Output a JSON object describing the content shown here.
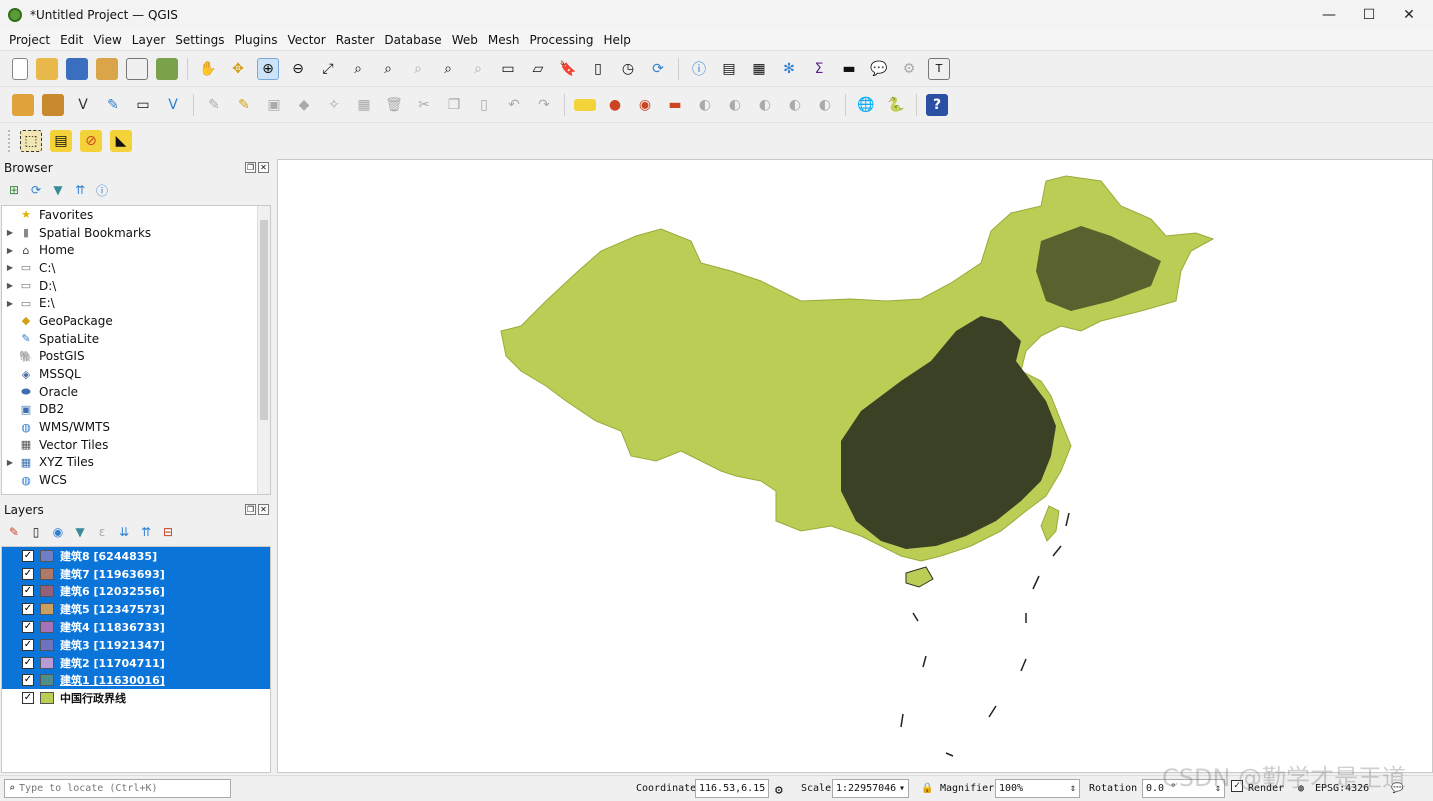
{
  "window": {
    "title": "*Untitled Project — QGIS",
    "minimize": "—",
    "maximize": "☐",
    "close": "✕"
  },
  "menu": [
    "Project",
    "Edit",
    "View",
    "Layer",
    "Settings",
    "Plugins",
    "Vector",
    "Raster",
    "Database",
    "Web",
    "Mesh",
    "Processing",
    "Help"
  ],
  "browser": {
    "title": "Browser",
    "items": [
      {
        "label": "Favorites",
        "icon": "star-icon",
        "expandable": false
      },
      {
        "label": "Spatial Bookmarks",
        "icon": "bookmark-icon",
        "expandable": true
      },
      {
        "label": "Home",
        "icon": "home-icon",
        "expandable": true
      },
      {
        "label": "C:\\",
        "icon": "folder-icon",
        "expandable": true
      },
      {
        "label": "D:\\",
        "icon": "folder-icon",
        "expandable": true
      },
      {
        "label": "E:\\",
        "icon": "folder-icon",
        "expandable": true
      },
      {
        "label": "GeoPackage",
        "icon": "geopackage-icon",
        "expandable": false
      },
      {
        "label": "SpatiaLite",
        "icon": "spatialite-icon",
        "expandable": false
      },
      {
        "label": "PostGIS",
        "icon": "postgis-icon",
        "expandable": false
      },
      {
        "label": "MSSQL",
        "icon": "mssql-icon",
        "expandable": false
      },
      {
        "label": "Oracle",
        "icon": "oracle-icon",
        "expandable": false
      },
      {
        "label": "DB2",
        "icon": "db2-icon",
        "expandable": false
      },
      {
        "label": "WMS/WMTS",
        "icon": "globe-icon",
        "expandable": false
      },
      {
        "label": "Vector Tiles",
        "icon": "grid-icon",
        "expandable": false
      },
      {
        "label": "XYZ Tiles",
        "icon": "tiles-icon",
        "expandable": true
      },
      {
        "label": "WCS",
        "icon": "globe-icon",
        "expandable": false
      }
    ]
  },
  "layers": {
    "title": "Layers",
    "items": [
      {
        "label": "建筑8 [6244835]",
        "color": "#6f7fc6",
        "selected": true
      },
      {
        "label": "建筑7 [11963693]",
        "color": "#b07868",
        "selected": true
      },
      {
        "label": "建筑6 [12032556]",
        "color": "#94607a",
        "selected": true
      },
      {
        "label": "建筑5 [12347573]",
        "color": "#c9a062",
        "selected": true
      },
      {
        "label": "建筑4 [11836733]",
        "color": "#a473b8",
        "selected": true
      },
      {
        "label": "建筑3 [11921347]",
        "color": "#6e72c0",
        "selected": true
      },
      {
        "label": "建筑2 [11704711]",
        "color": "#b79ad6",
        "selected": true
      },
      {
        "label": "建筑1 [11630016]",
        "color": "#4f8f8a",
        "selected": true
      },
      {
        "label": "中国行政界线",
        "color": "#bccd56",
        "selected": false
      }
    ]
  },
  "status": {
    "locate_placeholder": "Type to locate (Ctrl+K)",
    "coordinate_label": "Coordinate",
    "coordinate_value": "116.53,6.15",
    "scale_label": "Scale",
    "scale_value": "1:22957046",
    "magnifier_label": "Magnifier",
    "magnifier_value": "100%",
    "rotation_label": "Rotation",
    "rotation_value": "0.0 °",
    "render_label": "Render",
    "crs_label": "EPSG:4326"
  },
  "watermark": "CSDN @勤学才是王道",
  "colors": {
    "land": "#bccd56",
    "built": "#2f3520",
    "selection": "#0a74d8"
  }
}
